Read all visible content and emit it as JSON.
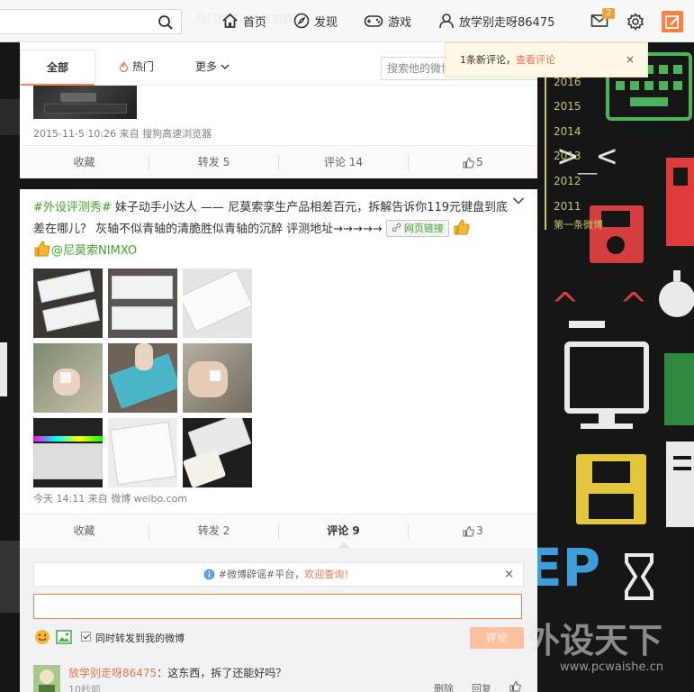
{
  "topnav": {
    "search_placeholder": "",
    "ghost_text": "...热门微博 | 正在加载 ...",
    "home": "首页",
    "discover": "发现",
    "game": "游戏",
    "username": "放学别走呀86475",
    "message_badge": "2",
    "colors": {
      "accent": "#ff8140",
      "badge": "#f49f37"
    }
  },
  "toast": {
    "text": "1条新评论，",
    "link": "查看评论",
    "close": "×"
  },
  "tabs": {
    "all": "全部",
    "hot": "热门",
    "more": "更多",
    "search_placeholder": "搜索他的微博"
  },
  "post1": {
    "meta": "2015-11-5 10:26 来自 搜狗高速浏览器",
    "actions": {
      "collect": "收藏",
      "repost": "转发 5",
      "comment": "评论 14",
      "like": "5"
    }
  },
  "post2": {
    "topic": "#外设评测秀#",
    "text_a": " 妹子动手小达人 —— 尼莫索孪生产品相差百元，拆解告诉你119元键盘到底差在哪儿？ 灰轴不似青轴的清脆胜似青轴的沉醉 评测地址→→→→→ ",
    "link_chip": "网页链接",
    "mention": "@尼莫索NIMXO",
    "meta": "今天 14:11 来自 微博 weibo.com",
    "actions": {
      "collect": "收藏",
      "repost": "转发 2",
      "comment": "评论 9",
      "like": "3"
    }
  },
  "comment_box": {
    "notice_a": "#微博辟谣#平台，",
    "notice_link": "欢迎查询！",
    "close": "×",
    "input_value": "",
    "repost_label": "同时转发到我的微博",
    "submit": "评论"
  },
  "reply": {
    "username": "放学别走呀86475",
    "text": "：这东西，拆了还能好吗？",
    "time": "10秒前",
    "delete": "删除",
    "reply": "回复"
  },
  "timeline": {
    "years": [
      "2016",
      "2015",
      "2014",
      "2013",
      "2012",
      "2011"
    ],
    "first_post": "第一条微博"
  },
  "watermark": {
    "big": "外设天下",
    "url": "www.pcwaishe.cn"
  }
}
